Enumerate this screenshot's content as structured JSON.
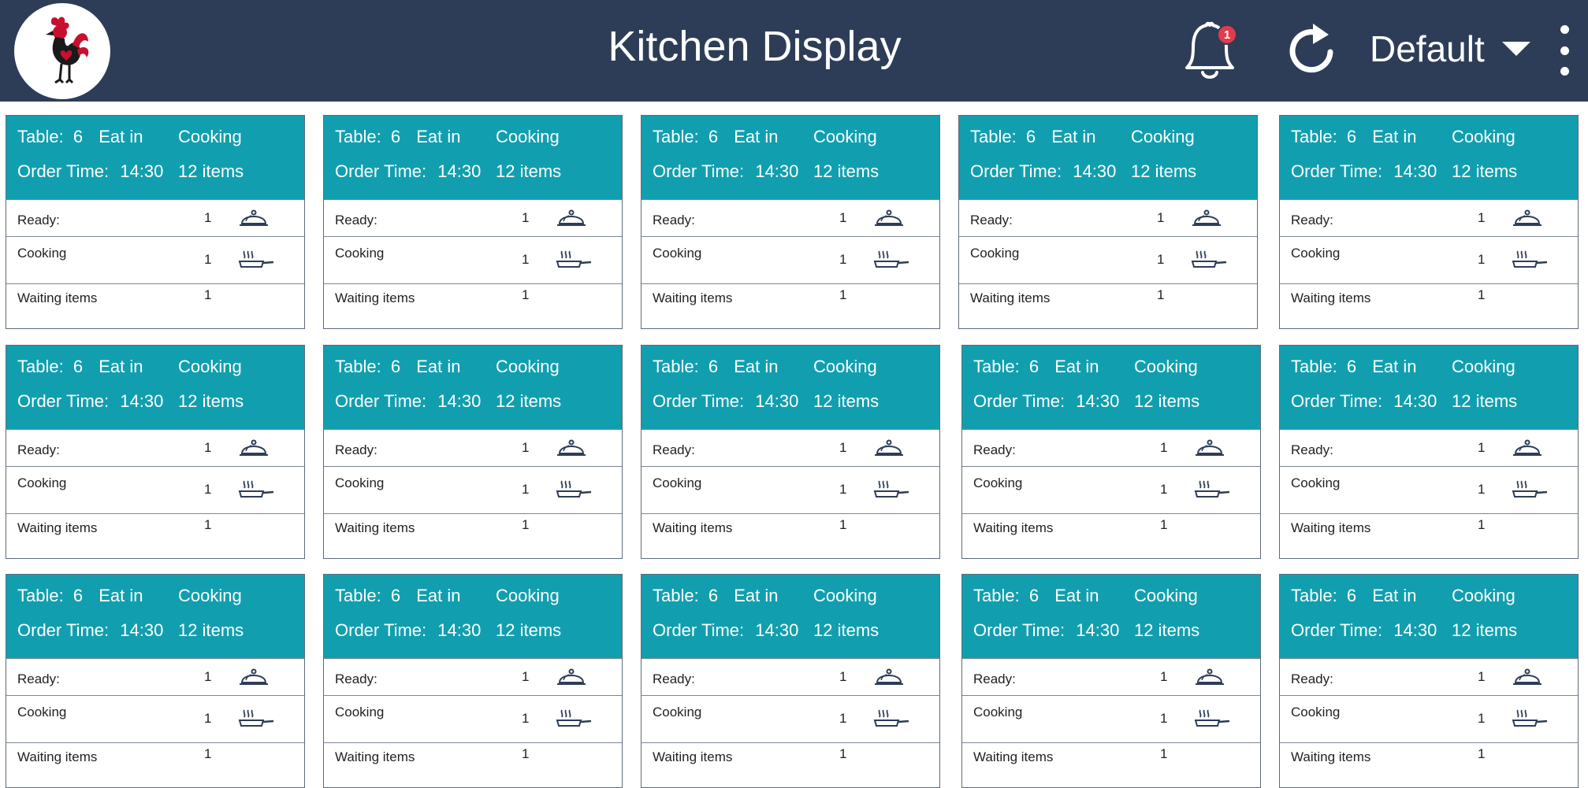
{
  "app": {
    "title": "Kitchen Display",
    "logo_icon": "rooster-logo-icon",
    "notifications": {
      "icon": "bell-icon",
      "count": "1"
    },
    "refresh_icon": "refresh-icon",
    "view_selector": {
      "value": "Default",
      "icon": "caret-down-icon"
    },
    "menu_icon": "more-vertical-icon"
  },
  "colors": {
    "header_bg": "#2e3d57",
    "card_header_bg": "#119faf",
    "badge": "#e23b4e",
    "logo_red": "#c8102e"
  },
  "orders": [
    {
      "table_label": "Table:",
      "table_no": "6",
      "service": "Eat in",
      "status": "Cooking",
      "time_label": "Order Time:",
      "time": "14:30",
      "items": "12 items",
      "rows": [
        {
          "label": "Ready:",
          "count": "1",
          "icon": "cloche-icon"
        },
        {
          "label": "Cooking",
          "count": "1",
          "icon": "frying-pan-icon"
        },
        {
          "label": "Waiting items",
          "count": "1"
        }
      ]
    },
    {
      "table_label": "Table:",
      "table_no": "6",
      "service": "Eat in",
      "status": "Cooking",
      "time_label": "Order Time:",
      "time": "14:30",
      "items": "12 items",
      "rows": [
        {
          "label": "Ready:",
          "count": "1",
          "icon": "cloche-icon"
        },
        {
          "label": "Cooking",
          "count": "1",
          "icon": "frying-pan-icon"
        },
        {
          "label": "Waiting items",
          "count": "1"
        }
      ]
    },
    {
      "table_label": "Table:",
      "table_no": "6",
      "service": "Eat in",
      "status": "Cooking",
      "time_label": "Order Time:",
      "time": "14:30",
      "items": "12 items",
      "rows": [
        {
          "label": "Ready:",
          "count": "1",
          "icon": "cloche-icon"
        },
        {
          "label": "Cooking",
          "count": "1",
          "icon": "frying-pan-icon"
        },
        {
          "label": "Waiting items",
          "count": "1"
        }
      ]
    },
    {
      "table_label": "Table:",
      "table_no": "6",
      "service": "Eat in",
      "status": "Cooking",
      "time_label": "Order Time:",
      "time": "14:30",
      "items": "12 items",
      "rows": [
        {
          "label": "Ready:",
          "count": "1",
          "icon": "cloche-icon"
        },
        {
          "label": "Cooking",
          "count": "1",
          "icon": "frying-pan-icon"
        },
        {
          "label": "Waiting items",
          "count": "1"
        }
      ]
    },
    {
      "table_label": "Table:",
      "table_no": "6",
      "service": "Eat in",
      "status": "Cooking",
      "time_label": "Order Time:",
      "time": "14:30",
      "items": "12 items",
      "rows": [
        {
          "label": "Ready:",
          "count": "1",
          "icon": "cloche-icon"
        },
        {
          "label": "Cooking",
          "count": "1",
          "icon": "frying-pan-icon"
        },
        {
          "label": "Waiting items",
          "count": "1"
        }
      ]
    },
    {
      "table_label": "Table:",
      "table_no": "6",
      "service": "Eat in",
      "status": "Cooking",
      "time_label": "Order Time:",
      "time": "14:30",
      "items": "12 items",
      "rows": [
        {
          "label": "Ready:",
          "count": "1",
          "icon": "cloche-icon"
        },
        {
          "label": "Cooking",
          "count": "1",
          "icon": "frying-pan-icon"
        },
        {
          "label": "Waiting items",
          "count": "1"
        }
      ]
    },
    {
      "table_label": "Table:",
      "table_no": "6",
      "service": "Eat in",
      "status": "Cooking",
      "time_label": "Order Time:",
      "time": "14:30",
      "items": "12 items",
      "rows": [
        {
          "label": "Ready:",
          "count": "1",
          "icon": "cloche-icon"
        },
        {
          "label": "Cooking",
          "count": "1",
          "icon": "frying-pan-icon"
        },
        {
          "label": "Waiting items",
          "count": "1"
        }
      ]
    },
    {
      "table_label": "Table:",
      "table_no": "6",
      "service": "Eat in",
      "status": "Cooking",
      "time_label": "Order Time:",
      "time": "14:30",
      "items": "12 items",
      "rows": [
        {
          "label": "Ready:",
          "count": "1",
          "icon": "cloche-icon"
        },
        {
          "label": "Cooking",
          "count": "1",
          "icon": "frying-pan-icon"
        },
        {
          "label": "Waiting items",
          "count": "1"
        }
      ]
    },
    {
      "table_label": "Table:",
      "table_no": "6",
      "service": "Eat in",
      "status": "Cooking",
      "time_label": "Order Time:",
      "time": "14:30",
      "items": "12 items",
      "rows": [
        {
          "label": "Ready:",
          "count": "1",
          "icon": "cloche-icon"
        },
        {
          "label": "Cooking",
          "count": "1",
          "icon": "frying-pan-icon"
        },
        {
          "label": "Waiting items",
          "count": "1"
        }
      ]
    },
    {
      "table_label": "Table:",
      "table_no": "6",
      "service": "Eat in",
      "status": "Cooking",
      "time_label": "Order Time:",
      "time": "14:30",
      "items": "12 items",
      "rows": [
        {
          "label": "Ready:",
          "count": "1",
          "icon": "cloche-icon"
        },
        {
          "label": "Cooking",
          "count": "1",
          "icon": "frying-pan-icon"
        },
        {
          "label": "Waiting items",
          "count": "1"
        }
      ]
    },
    {
      "table_label": "Table:",
      "table_no": "6",
      "service": "Eat in",
      "status": "Cooking",
      "time_label": "Order Time:",
      "time": "14:30",
      "items": "12 items",
      "rows": [
        {
          "label": "Ready:",
          "count": "1",
          "icon": "cloche-icon"
        },
        {
          "label": "Cooking",
          "count": "1",
          "icon": "frying-pan-icon"
        },
        {
          "label": "Waiting items",
          "count": "1"
        }
      ]
    },
    {
      "table_label": "Table:",
      "table_no": "6",
      "service": "Eat in",
      "status": "Cooking",
      "time_label": "Order Time:",
      "time": "14:30",
      "items": "12 items",
      "rows": [
        {
          "label": "Ready:",
          "count": "1",
          "icon": "cloche-icon"
        },
        {
          "label": "Cooking",
          "count": "1",
          "icon": "frying-pan-icon"
        },
        {
          "label": "Waiting items",
          "count": "1"
        }
      ]
    },
    {
      "table_label": "Table:",
      "table_no": "6",
      "service": "Eat in",
      "status": "Cooking",
      "time_label": "Order Time:",
      "time": "14:30",
      "items": "12 items",
      "rows": [
        {
          "label": "Ready:",
          "count": "1",
          "icon": "cloche-icon"
        },
        {
          "label": "Cooking",
          "count": "1",
          "icon": "frying-pan-icon"
        },
        {
          "label": "Waiting items",
          "count": "1"
        }
      ]
    },
    {
      "table_label": "Table:",
      "table_no": "6",
      "service": "Eat in",
      "status": "Cooking",
      "time_label": "Order Time:",
      "time": "14:30",
      "items": "12 items",
      "rows": [
        {
          "label": "Ready:",
          "count": "1",
          "icon": "cloche-icon"
        },
        {
          "label": "Cooking",
          "count": "1",
          "icon": "frying-pan-icon"
        },
        {
          "label": "Waiting items",
          "count": "1"
        }
      ]
    },
    {
      "table_label": "Table:",
      "table_no": "6",
      "service": "Eat in",
      "status": "Cooking",
      "time_label": "Order Time:",
      "time": "14:30",
      "items": "12 items",
      "rows": [
        {
          "label": "Ready:",
          "count": "1",
          "icon": "cloche-icon"
        },
        {
          "label": "Cooking",
          "count": "1",
          "icon": "frying-pan-icon"
        },
        {
          "label": "Waiting items",
          "count": "1"
        }
      ]
    }
  ]
}
